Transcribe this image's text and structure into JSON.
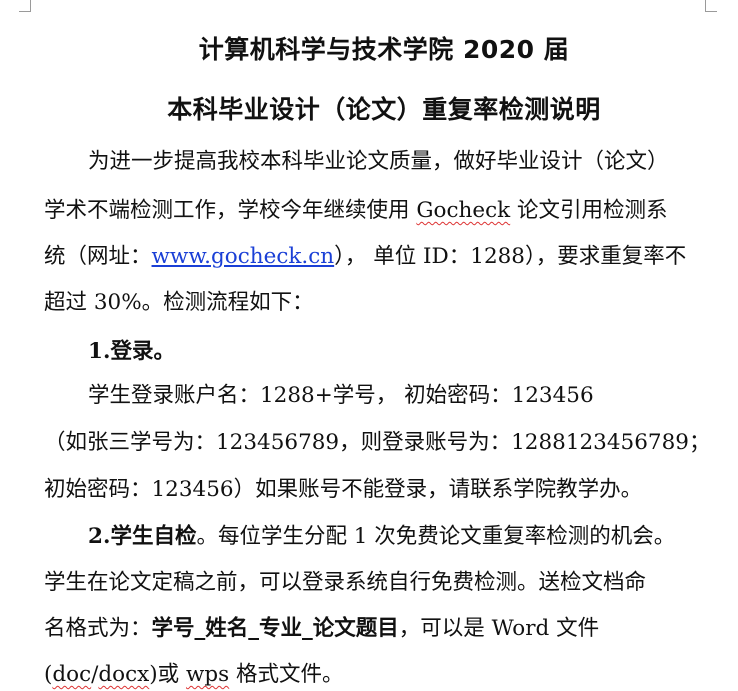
{
  "title_line1": "计算机科学与技术学院 2020 届",
  "title_line2": "本科毕业设计（论文）重复率检测说明",
  "intro": {
    "line1": "为进一步提高我校本科毕业论文质量，做好毕业设计（论文）",
    "line2_a": "学术不端检测工作，学校今年继续使用 ",
    "line2_brand": "Gocheck",
    "line2_b": " 论文引用检测系",
    "line3_a": "统（网址：",
    "line3_url": "www.gocheck.cn",
    "line3_b": "）， 单位 ID：1288），要求重复率不",
    "line4": "超过 30%。检测流程如下："
  },
  "section1": {
    "heading": "1.登录。",
    "line1": "学生登录账户名：1288+学号，    初始密码：123456",
    "line2": "（如张三学号为：123456789，则登录账号为：1288123456789；",
    "line3": "初始密码：123456）如果账号不能登录，请联系学院教学办。"
  },
  "section2": {
    "heading": "2.学生自检",
    "line1_rest": "。每位学生分配 1 次免费论文重复率检测的机会。",
    "line2": "学生在论文定稿之前，可以登录系统自行免费检测。送检文档命",
    "line3_a": "名格式为：",
    "line3_bold": "学号_姓名_专业_论文题目",
    "line3_b": "，可以是 Word 文件",
    "line4_a": "(",
    "line4_doc": "doc",
    "line4_sep": "/",
    "line4_docx": "docx",
    "line4_b": ")或 ",
    "line4_wps": "wps",
    "line4_c": " 格式文件。"
  }
}
